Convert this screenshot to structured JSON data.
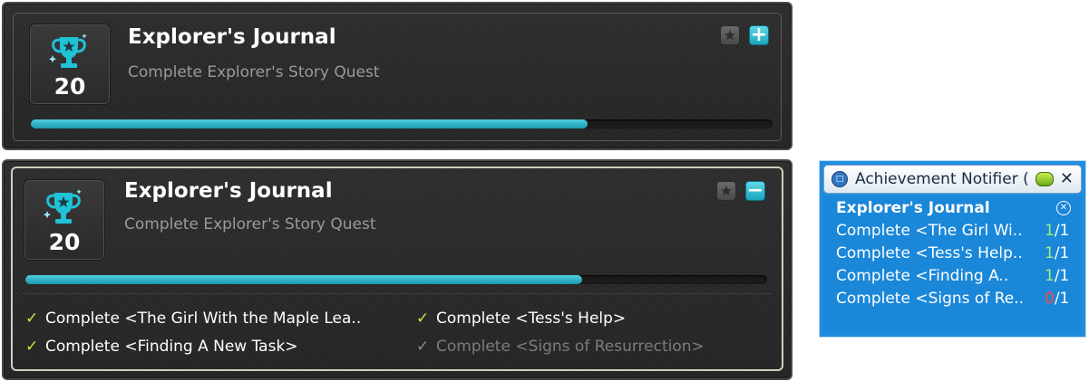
{
  "collapsed_card": {
    "title": "Explorer's Journal",
    "description": "Complete Explorer's Story Quest",
    "points": "20",
    "progress_fraction": 0.75,
    "icon": "trophy-icon",
    "expand_button_icon": "plus-icon",
    "favorite_button_icon": "star-icon"
  },
  "expanded_card": {
    "title": "Explorer's Journal",
    "description": "Complete Explorer's Story Quest",
    "points": "20",
    "progress_fraction": 0.75,
    "icon": "trophy-icon",
    "collapse_button_icon": "minus-icon",
    "favorite_button_icon": "star-icon",
    "tasks": [
      {
        "label": "Complete <The Girl With the Maple Lea..",
        "done": true
      },
      {
        "label": "Complete <Tess's Help>",
        "done": true
      },
      {
        "label": "Complete <Finding A New Task>",
        "done": true
      },
      {
        "label": "Complete <Signs of Resurrection>",
        "done": false
      }
    ]
  },
  "notifier": {
    "title": "Achievement Notifier (",
    "achievement": "Explorer's Journal",
    "rows": [
      {
        "label": "Complete <The Girl Wi..",
        "current": "1",
        "total": "/1"
      },
      {
        "label": "Complete <Tess's Help..",
        "current": "1",
        "total": "/1"
      },
      {
        "label": "Complete <Finding A..",
        "current": "1",
        "total": "/1"
      },
      {
        "label": "Complete <Signs of Re..",
        "current": "0",
        "total": "/1"
      }
    ],
    "colors": {
      "background": "#1f8ee0",
      "done": "#9ef07a",
      "not_done": "#ff4a3a"
    }
  }
}
